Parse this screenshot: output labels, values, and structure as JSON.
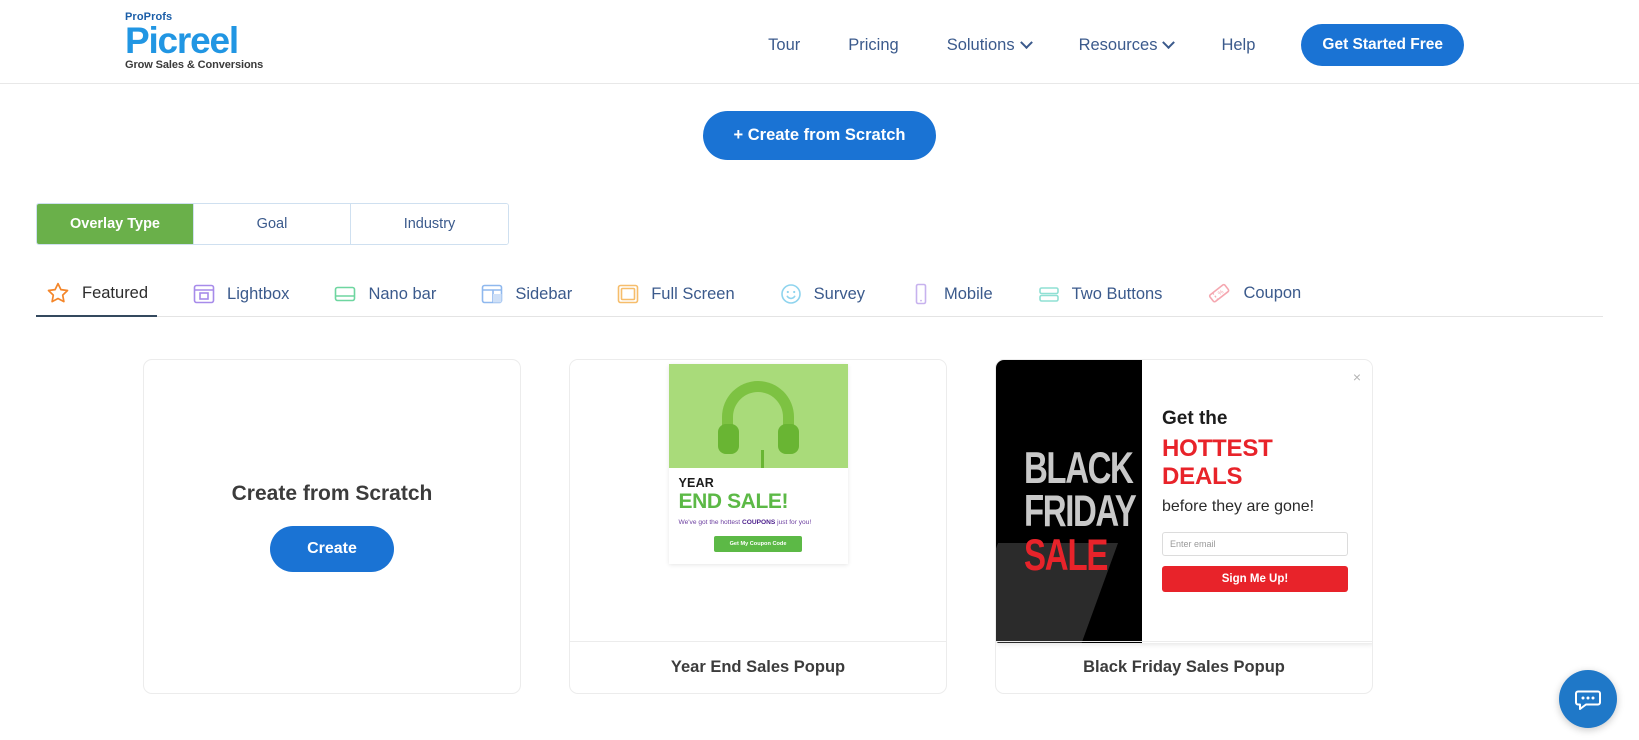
{
  "header": {
    "logo": {
      "pro": "ProProfs",
      "name": "Picreel",
      "tagline": "Grow Sales & Conversions"
    },
    "nav": [
      {
        "label": "Tour",
        "caret": false
      },
      {
        "label": "Pricing",
        "caret": false
      },
      {
        "label": "Solutions",
        "caret": true
      },
      {
        "label": "Resources",
        "caret": true
      },
      {
        "label": "Help",
        "caret": false
      }
    ],
    "cta": "Get Started Free"
  },
  "scratch_button": "+ Create from Scratch",
  "segmented": {
    "items": [
      {
        "label": "Overlay Type",
        "active": true
      },
      {
        "label": "Goal",
        "active": false
      },
      {
        "label": "Industry",
        "active": false
      }
    ],
    "active_color": "#6ab04a"
  },
  "tabs": [
    {
      "label": "Featured",
      "icon": "star-icon",
      "color": "#f4862a",
      "active": true
    },
    {
      "label": "Lightbox",
      "icon": "lightbox-icon",
      "color": "#a78bea",
      "active": false
    },
    {
      "label": "Nano bar",
      "icon": "nano-bar-icon",
      "color": "#6ed6a0",
      "active": false
    },
    {
      "label": "Sidebar",
      "icon": "sidebar-icon",
      "color": "#8fb8ee",
      "active": false
    },
    {
      "label": "Full Screen",
      "icon": "full-screen-icon",
      "color": "#f6bd6b",
      "active": false
    },
    {
      "label": "Survey",
      "icon": "survey-icon",
      "color": "#8fd4ee",
      "active": false
    },
    {
      "label": "Mobile",
      "icon": "mobile-icon",
      "color": "#c7b2ee",
      "active": false
    },
    {
      "label": "Two Buttons",
      "icon": "two-buttons-icon",
      "color": "#8fe0d4",
      "active": false
    },
    {
      "label": "Coupon",
      "icon": "coupon-icon",
      "color": "#f5a7b0",
      "active": false
    }
  ],
  "cards": {
    "scratch": {
      "title": "Create from Scratch",
      "button": "Create"
    },
    "year_end": {
      "caption": "Year End Sales Popup",
      "heading_top": "YEAR",
      "heading_main": "END SALE!",
      "sub_pre": "We've got the hottest ",
      "sub_bold": "COUPONS",
      "sub_post": " just for you!",
      "button": "Get My Coupon Code"
    },
    "black_friday": {
      "caption": "Black Friday Sales Popup",
      "art_line1": "BLACK",
      "art_line2": "FRIDAY",
      "art_line3": "SALE",
      "heading1": "Get the",
      "heading2": "HOTTEST DEALS",
      "heading3": "before they are gone!",
      "email_placeholder": "Enter email",
      "button": "Sign Me Up!",
      "close": "×"
    }
  },
  "chat_widget": {
    "icon": "chat-bubble-icon"
  }
}
